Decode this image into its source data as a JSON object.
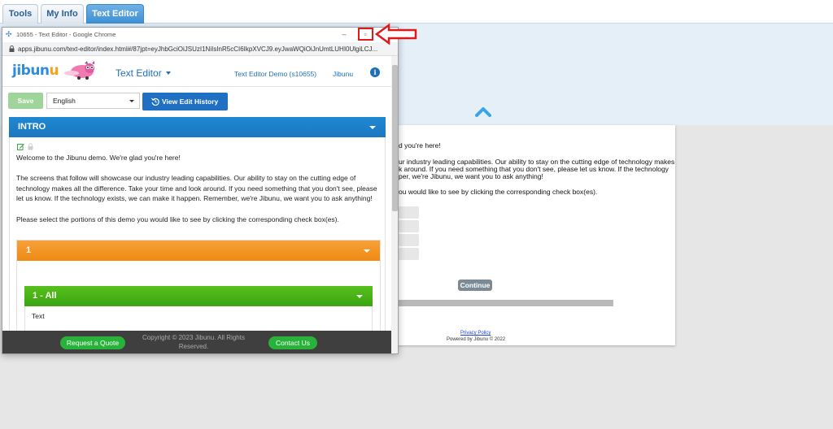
{
  "top_tabs": [
    {
      "label": "Tools"
    },
    {
      "label": "My Info"
    },
    {
      "label": "Text Editor",
      "active": true
    }
  ],
  "preview": {
    "lines": [
      "d you're here!",
      "ur industry leading capabilities. Our ability to stay on the cutting edge of technology makes",
      "k around. If you need something that you don't see, please let us know. If the technology",
      "per, we're Jibunu, we want you to ask anything!",
      "ou would like to see by clicking the corresponding check box(es)."
    ],
    "continue_label": "Continue",
    "privacy_label": "Privacy Policy",
    "powered_label": "Powered by Jibunu © 2022"
  },
  "window": {
    "title": "10655 - Text Editor - Google Chrome",
    "url": "apps.jibunu.com/text-editor/index.html#/87jpt=eyJhbGciOiJSUzI1NiIsInR5cCI6IkpXVCJ9.eyJwaWQiOiJnUmtLUHI0UlgiLCJ..."
  },
  "app": {
    "logo_text_a": "jibun",
    "logo_text_b": "u",
    "title": "Text Editor",
    "demo_label": "Text Editor Demo (s10655)",
    "user_label": "Jibunu",
    "info_glyph": "i",
    "save_label": "Save",
    "language": "English",
    "history_label": "View Edit History"
  },
  "intro": {
    "heading": "INTRO",
    "paragraphs": [
      "Welcome to the Jibunu demo. We're glad you're here!",
      "The screens that follow will showcase our industry leading capabilities. Our ability to stay on the cutting edge of technology makes all the difference. Take your time and look around. If you need something that you don't see, please let us know. If the technology exists, we can make it happen. Remember, we're Jibunu, we want you to ask anything!",
      "Please select the portions of this demo you would like to see by clicking the corresponding check box(es)."
    ]
  },
  "section1": {
    "heading": "1",
    "sub_heading": "1 - All",
    "sub_text": "Text"
  },
  "footer": {
    "quote_label": "Request a Quote",
    "copyright": "Copyright © 2023 Jibunu. All Rights Reserved.",
    "contact_label": "Contact Us"
  },
  "colors": {
    "accent_blue": "#1d6fb8",
    "intro_blue": "#1f88d2",
    "section_orange": "#f08a12",
    "subsection_green": "#3aa511",
    "footer_dark": "#3f3f3f",
    "button_green": "#29b23a",
    "highlight_red": "#e01919"
  }
}
